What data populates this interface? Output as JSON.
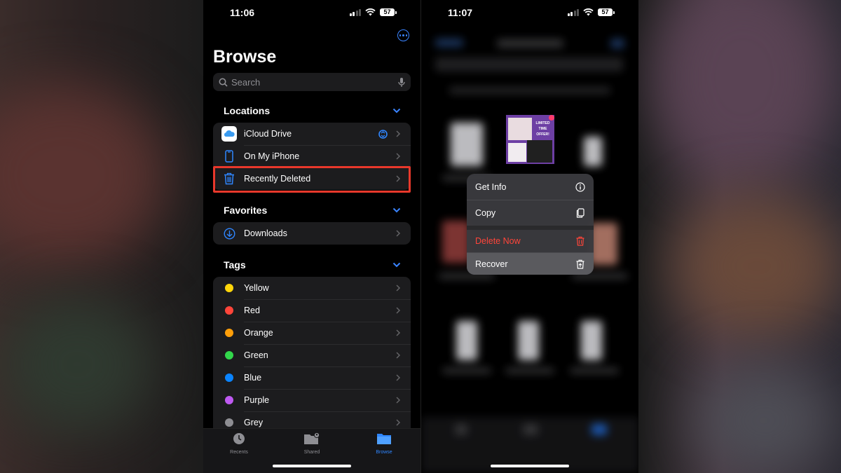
{
  "left_phone": {
    "status": {
      "time": "11:06",
      "battery": "57"
    },
    "title": "Browse",
    "search": {
      "placeholder": "Search"
    },
    "locations": {
      "header": "Locations",
      "items": [
        {
          "label": "iCloud Drive",
          "icon": "icloud-icon"
        },
        {
          "label": "On My iPhone",
          "icon": "iphone-icon"
        },
        {
          "label": "Recently Deleted",
          "icon": "trash-icon"
        }
      ]
    },
    "favorites": {
      "header": "Favorites",
      "items": [
        {
          "label": "Downloads",
          "icon": "download-icon"
        }
      ]
    },
    "tags": {
      "header": "Tags",
      "items": [
        {
          "label": "Yellow",
          "color": "#ffd60a"
        },
        {
          "label": "Red",
          "color": "#ff453a"
        },
        {
          "label": "Orange",
          "color": "#ff9f0a"
        },
        {
          "label": "Green",
          "color": "#32d74b"
        },
        {
          "label": "Blue",
          "color": "#0a84ff"
        },
        {
          "label": "Purple",
          "color": "#bf5af2"
        },
        {
          "label": "Grey",
          "color": "#8e8e93"
        }
      ]
    },
    "tabbar": {
      "tabs": [
        {
          "label": "Recents",
          "icon": "clock-icon"
        },
        {
          "label": "Shared",
          "icon": "shared-folder-icon"
        },
        {
          "label": "Browse",
          "icon": "folder-icon",
          "active": true
        }
      ]
    }
  },
  "right_phone": {
    "status": {
      "time": "11:07",
      "battery": "57"
    },
    "thumbnail_text": "LIMITED TIME OFFER!",
    "context_menu": {
      "items": [
        {
          "label": "Get Info",
          "icon": "info-icon"
        },
        {
          "label": "Copy",
          "icon": "copy-icon"
        },
        {
          "label": "Delete Now",
          "icon": "trash-icon",
          "destructive": true
        },
        {
          "label": "Recover",
          "icon": "recover-icon"
        }
      ]
    }
  },
  "colors": {
    "accent": "#2f86ff",
    "highlight_box": "#e8382b",
    "destructive": "#ff453a"
  }
}
